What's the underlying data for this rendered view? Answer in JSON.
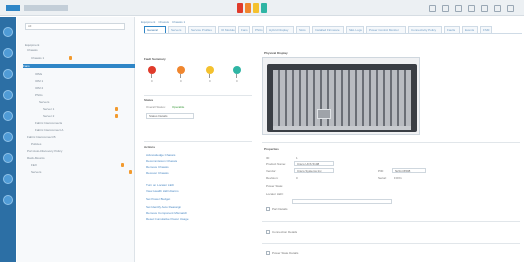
{
  "app": {
    "title": "UCS Manager"
  },
  "colors": {
    "rail": "#2c6fa5",
    "accent": "#2f86c7",
    "badge": "#f29a2e",
    "fault_critical": "#e03b2b",
    "fault_major": "#f0862e",
    "fault_minor": "#f4c12e",
    "fault_warning": "#2fb5a4"
  },
  "tree": {
    "search_placeholder": "All",
    "nodes": [
      {
        "label": "Equipment"
      },
      {
        "label": "Chassis"
      },
      {
        "label": "Chassis 1"
      },
      {
        "label": "Fans"
      },
      {
        "label": "IOMs"
      },
      {
        "label": "IOM 1"
      },
      {
        "label": "IOM 2"
      },
      {
        "label": "PSUs"
      },
      {
        "label": "Servers"
      },
      {
        "label": "Server 1"
      },
      {
        "label": "Server 2"
      },
      {
        "label": "Fabric Interconnects"
      },
      {
        "label": "Fabric Interconnect A"
      },
      {
        "label": "Fabric Interconnect B"
      },
      {
        "label": "Policies"
      },
      {
        "label": "Port Auto-Discovery Policy"
      },
      {
        "label": "Rack-Mounts"
      },
      {
        "label": "FEX"
      },
      {
        "label": "Servers"
      }
    ]
  },
  "main": {
    "breadcrumb": [
      "Equipment",
      "Chassis",
      "Chassis 1"
    ],
    "tabs": [
      "General",
      "Servers",
      "Service Profiles",
      "IO Modules",
      "Fans",
      "PSUs",
      "Hybrid Display",
      "Slots",
      "Installed Firmware",
      "SEL Logs",
      "Power Control Monitor",
      "Connectivity Policy",
      "Faults",
      "Events",
      "FSM"
    ],
    "fault_summary": {
      "title": "Fault Summary",
      "counts": [
        "0",
        "0",
        "0",
        "0"
      ]
    },
    "status": {
      "title": "Status",
      "overall_label": "Overall Status:",
      "overall_value": "Operable",
      "status_details": "Status Details"
    },
    "actions": {
      "title": "Actions",
      "links": [
        "Acknowledge Chassis",
        "Decommission Chassis",
        "Remove Chassis",
        "Recover Chassis",
        "Turn on Locator LED",
        "View Health LED Alarms",
        "Set Power Budget",
        "Set Identify Auto Reassign",
        "Remove Component Mismatch",
        "Reset Cumulative Power Usage"
      ]
    },
    "physical_display": {
      "title": "Physical Display"
    },
    "properties": {
      "title": "Properties",
      "id_label": "ID:",
      "id_value": "1",
      "product_name_label": "Product Name:",
      "product_name_value": "Cisco UCS 5108",
      "vendor_label": "Vendor:",
      "vendor_value": "Cisco Systems Inc",
      "pid_label": "PID:",
      "pid_value": "N20-C6508",
      "revision_label": "Revision:",
      "revision_value": "0",
      "serial_label": "Serial:",
      "serial_value": "FOX1",
      "power_state_label": "Power State:",
      "power_state_value": "",
      "locator_label": "Locator LED:",
      "locator_value": "",
      "part_details": "Part Details",
      "connection_details": "Connection Details",
      "power_details": "Power State Details"
    }
  }
}
